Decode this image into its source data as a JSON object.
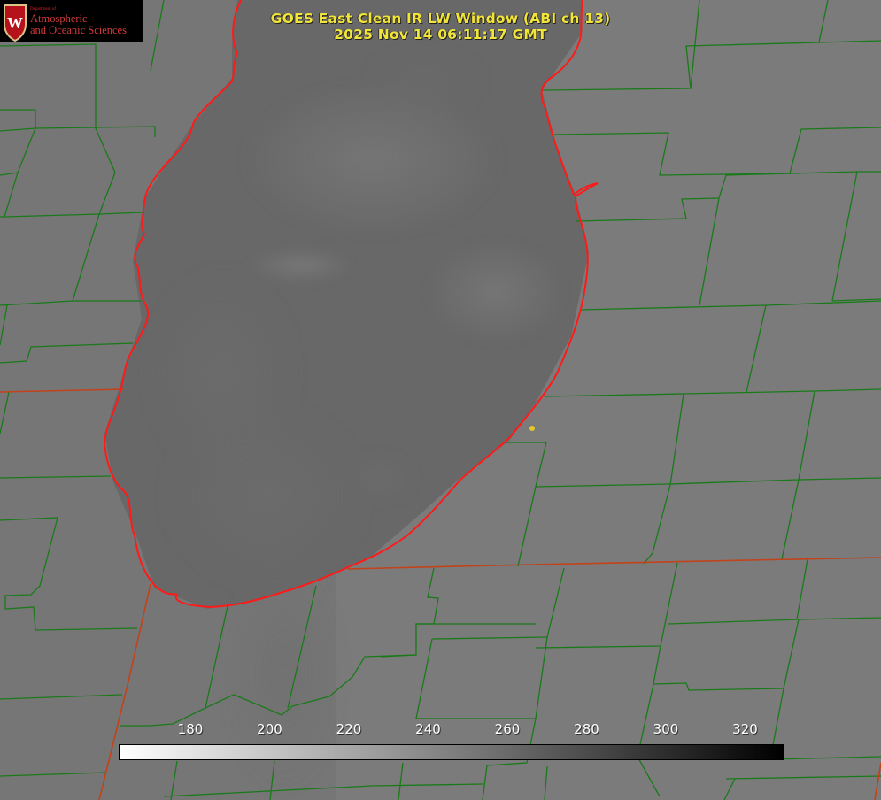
{
  "title": {
    "line1": "GOES East Clean IR LW Window (ABI ch 13)",
    "line2": "2025 Nov 14 06:11:17 GMT"
  },
  "logo": {
    "dept": "Department of",
    "line1": "Atmospheric",
    "line2": "and Oceanic Sciences",
    "emblem_letter": "W"
  },
  "colorbar": {
    "ticks": [
      "180",
      "200",
      "220",
      "240",
      "260",
      "280",
      "300",
      "320"
    ],
    "gradient": [
      "#ffffff",
      "#000000"
    ]
  },
  "colors": {
    "county_lines": "#1a7a1a",
    "state_lines": "#c2421a",
    "lake_shoreline": "#ff1a1a",
    "title_text": "#f2e53a",
    "marker": "#e3c72b"
  }
}
